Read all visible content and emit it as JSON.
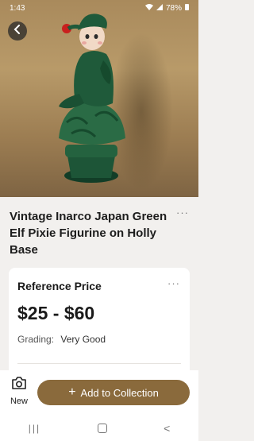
{
  "status": {
    "time": "1:43",
    "battery": "78%",
    "icons": [
      "wifi-icon",
      "signal-icon",
      "battery-icon"
    ]
  },
  "item": {
    "title": "Vintage Inarco Japan Green Elf Pixie Figurine on Holly Base",
    "more_glyph": "···"
  },
  "price_card": {
    "heading": "Reference Price",
    "more_glyph": "···",
    "price_range": "$25 - $60",
    "grading_label": "Grading:",
    "grading_value": "Very Good"
  },
  "bottom": {
    "new_label": "New",
    "add_label": "Add to Collection",
    "add_icon": "+"
  },
  "nav": {
    "recent": "|||",
    "back": "<"
  },
  "colors": {
    "accent": "#8a6a3c",
    "figurine_green": "#1f5a3a"
  }
}
